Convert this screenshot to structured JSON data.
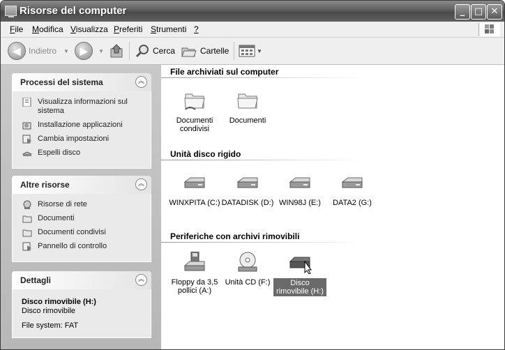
{
  "window": {
    "title": "Risorse del computer",
    "btn_min": "_",
    "btn_max": "□",
    "btn_close": "✕"
  },
  "menu": [
    "File",
    "Modifica",
    "Visualizza",
    "Preferiti",
    "Strumenti",
    "?"
  ],
  "toolbar": {
    "back": "Indietro",
    "search": "Cerca",
    "folders": "Cartelle"
  },
  "tasks": {
    "system": {
      "title": "Processi del sistema",
      "items": [
        "Visualizza informazioni sul sistema",
        "Installazione applicazioni",
        "Cambia impostazioni",
        "Espelli disco"
      ]
    },
    "other": {
      "title": "Altre risorse",
      "items": [
        "Risorse di rete",
        "Documenti",
        "Documenti condivisi",
        "Pannello di controllo"
      ]
    },
    "details": {
      "title": "Dettagli",
      "name": "Disco rimovibile (H:)",
      "type": "Disco rimovibile",
      "fs": "File system: FAT"
    }
  },
  "groups": {
    "stored": {
      "title": "File archiviati sul computer",
      "items": [
        "Documenti condivisi",
        "Documenti"
      ]
    },
    "disks": {
      "title": "Unità disco rigido",
      "items": [
        "WINXPITA (C:)",
        "DATADISK (D:)",
        "WIN98J (E:)",
        "DATA2 (G:)"
      ]
    },
    "removable": {
      "title": "Periferiche con archivi rimovibili",
      "items": [
        "Floppy da 3,5 pollici (A:)",
        "Unità CD (F:)",
        "Disco rimovibile (H:)"
      ]
    }
  }
}
